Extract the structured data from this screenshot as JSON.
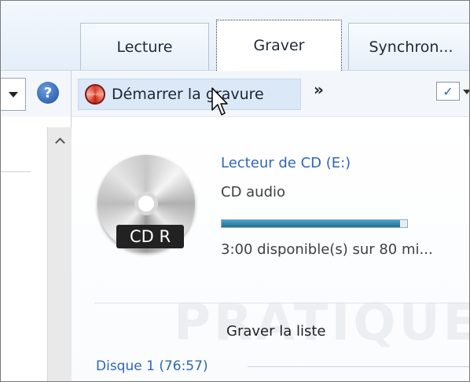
{
  "tabs": [
    {
      "label": "Lecture",
      "active": false
    },
    {
      "label": "Graver",
      "active": true
    },
    {
      "label": "Synchron...",
      "active": false
    }
  ],
  "toolbar": {
    "start_burn_label": "Démarrer la gravure",
    "more_label": "»",
    "help_label": "?",
    "options_icon": "✓"
  },
  "drive": {
    "name": "Lecteur de CD (E:)",
    "media": "CD audio",
    "badge": "CD R",
    "capacity": "3:00 disponible(s) sur 80 mi...",
    "used_fraction": 0.96
  },
  "burn_list": {
    "title": "Graver la liste",
    "disc_label": "Disque 1 (76:57)"
  },
  "watermark": "PRATIQUES",
  "colors": {
    "link_blue": "#2f67b3",
    "progress": "#1f6d96",
    "highlight": "#dbe8f7"
  }
}
